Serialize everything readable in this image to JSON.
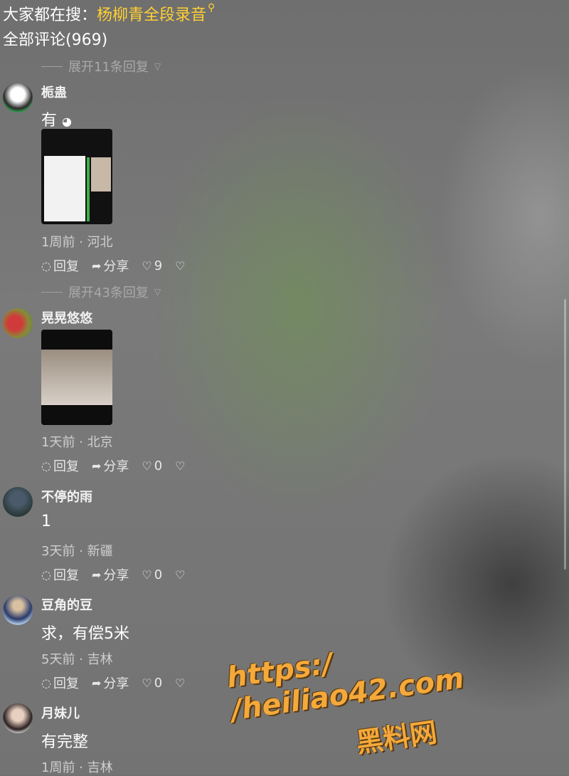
{
  "header": {
    "search_prefix": "大家都在搜：",
    "search_keyword": "杨柳青全段录音",
    "comment_count": "全部评论(969)"
  },
  "expand_replies": [
    "展开11条回复",
    "展开43条回复"
  ],
  "comments": [
    {
      "user": "栀蛊",
      "text": "有",
      "time_loc": "1周前 · 河北",
      "likes": "9",
      "has_sticker": true
    },
    {
      "user": "晃晃悠悠",
      "text": "",
      "time_loc": "1天前 · 北京",
      "likes": "0"
    },
    {
      "user": "不停的雨",
      "text": "1",
      "time_loc": "3天前 · 新疆",
      "likes": "0"
    },
    {
      "user": "豆角的豆",
      "text": "求，有偿5米",
      "time_loc": "5天前 · 吉林",
      "likes": "0"
    },
    {
      "user": "月妹儿",
      "text": "有完整",
      "time_loc": "1周前 · 吉林",
      "likes": ""
    }
  ],
  "actions": {
    "reply": "回复",
    "share": "分享"
  },
  "watermark": {
    "url": "https:/ /heiliao42.com",
    "name": "黑料网"
  },
  "colors": {
    "keyword": "#ffd033",
    "watermark": "#f4a93a"
  }
}
